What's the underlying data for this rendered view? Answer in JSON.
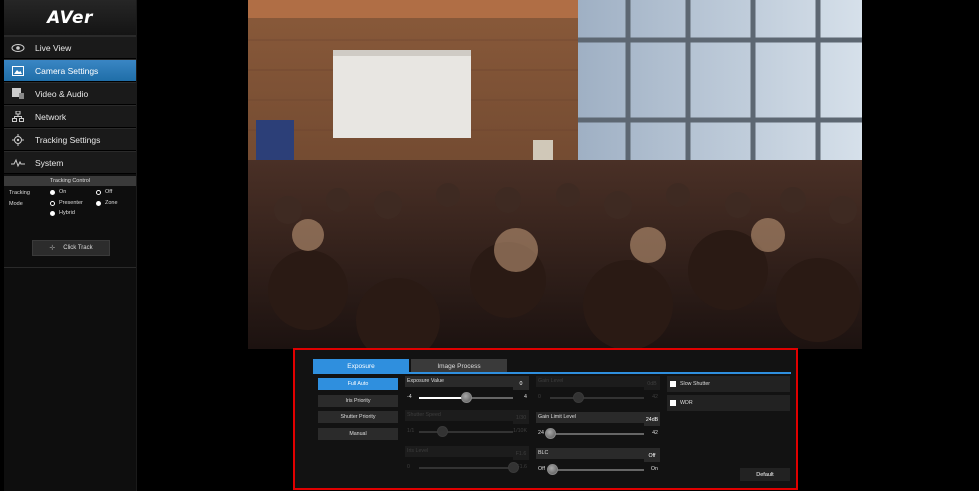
{
  "brand": {
    "logo_text": "AVer"
  },
  "sidebar": {
    "items": [
      {
        "label": "Live View",
        "icon": "eye-icon",
        "active": false
      },
      {
        "label": "Camera Settings",
        "icon": "image-icon",
        "active": true
      },
      {
        "label": "Video & Audio",
        "icon": "video-audio-icon",
        "active": false
      },
      {
        "label": "Network",
        "icon": "network-icon",
        "active": false
      },
      {
        "label": "Tracking Settings",
        "icon": "target-icon",
        "active": false
      },
      {
        "label": "System",
        "icon": "pulse-icon",
        "active": false
      }
    ]
  },
  "tracking_control": {
    "header": "Tracking Control",
    "tracking_label": "Tracking",
    "mode_label": "Mode",
    "on_label": "On",
    "off_label": "Off",
    "presenter_label": "Presenter",
    "zone_label": "Zone",
    "hybrid_label": "Hybrid",
    "click_track_label": "Click Track"
  },
  "panel": {
    "tabs": [
      "Exposure",
      "Image Process"
    ],
    "modes": [
      "Full Auto",
      "Iris Priority",
      "Shutter Priority",
      "Manual"
    ],
    "exposure_value": {
      "label": "Exposure Value",
      "value": "0",
      "min": "-4",
      "max": "4",
      "level": 0.5
    },
    "shutter_speed": {
      "label": "Shutter Speed",
      "value": "1/30",
      "min": "1/1",
      "max": "1/10K",
      "level": 0.25
    },
    "iris_level": {
      "label": "Iris Level",
      "value": "F1.6",
      "min": "0",
      "max": "F1.6",
      "level": 1.0
    },
    "gain_level": {
      "label": "Gain Level",
      "value": "0dB",
      "min": "0",
      "max": "42",
      "level": 0.3
    },
    "gain_limit_level": {
      "label": "Gain Limit Level",
      "value": "24dB",
      "min": "24",
      "max": "42",
      "level": 0.0
    },
    "blc": {
      "label": "BLC",
      "value": "Off",
      "min": "Off",
      "max": "On",
      "level": 0.0
    },
    "slow_shutter_label": "Slow Shutter",
    "wdr_label": "WDR",
    "default_label": "Default"
  },
  "colors": {
    "accent": "#2f8fde",
    "highlight_border": "#e00000"
  }
}
